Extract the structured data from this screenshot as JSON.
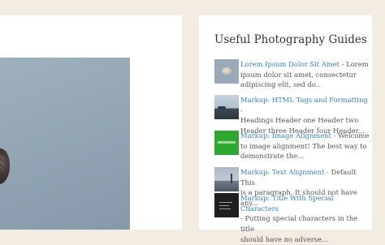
{
  "sidebar": {
    "title": "Useful Photography Guides",
    "items": [
      {
        "link": "Lorem Ipsum Dolor Sit Amet",
        "separator": " - ",
        "excerpt_lines": [
          "Lorem",
          "ipsum dolor sit amet, consectetur",
          "adipiscing elit, sed do.."
        ],
        "thumbnail_icon": "pebble-photo-icon"
      },
      {
        "link": "Markup: HTML Tags and Formatting",
        "separator": " - ",
        "excerpt_lines": [
          "",
          "Headings Header one Header two",
          "Header three Header four Header..."
        ],
        "thumbnail_icon": "coast-photo-icon"
      },
      {
        "link": "Markup: Image Alignment",
        "separator": " - ",
        "excerpt_lines": [
          "Welcome",
          "to image alignment! The best way to",
          "demonstrate the..."
        ],
        "thumbnail_icon": "green-image-icon"
      },
      {
        "link": "Markup: Text Alignment",
        "separator": " - ",
        "excerpt_lines": [
          "Default This",
          "is a paragraph. It should not have any...",
          ""
        ],
        "thumbnail_icon": "pier-photo-icon"
      },
      {
        "link": "Markup: Title With Special Characters",
        "separator": "",
        "excerpt_lines": [
          "",
          "- Putting special characters in the title",
          "should have no adverse..."
        ],
        "thumbnail_icon": "dark-text-image-icon"
      }
    ]
  }
}
